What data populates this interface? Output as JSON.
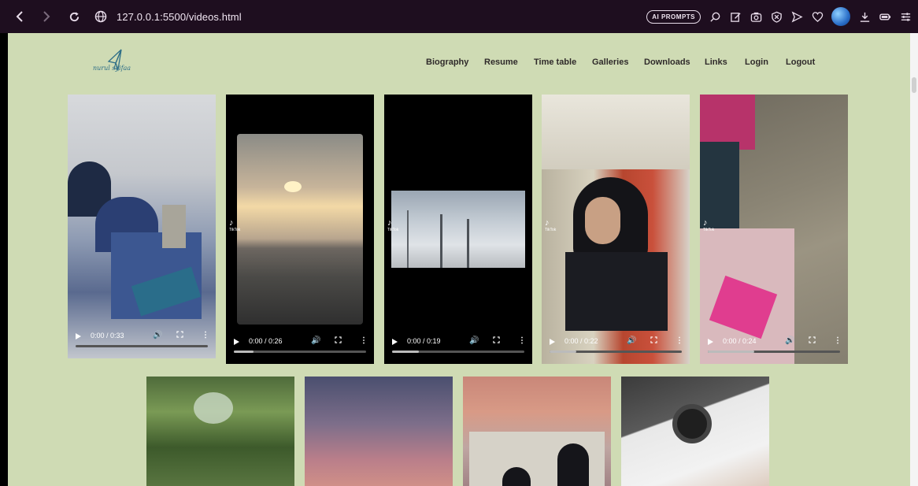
{
  "browser": {
    "url": "127.0.0.1:5500/videos.html",
    "ai_button_label": "AI PROMPTS",
    "back_icon": "chevron-left-icon",
    "forward_icon": "chevron-right-icon",
    "reload_icon": "reload-icon",
    "site_icon": "globe-icon"
  },
  "site": {
    "logo_text": "nurul syifaa",
    "nav": [
      "Biography",
      "Resume",
      "Time table",
      "Galleries",
      "Downloads",
      "Links",
      "Login",
      "Logout"
    ]
  },
  "videos": [
    {
      "time": "0:00 / 0:33",
      "progress": 0.0
    },
    {
      "time": "0:00 / 0:26",
      "progress": 0.15,
      "tiktok": "TikTok"
    },
    {
      "time": "0:00 / 0:19",
      "progress": 0.2,
      "tiktok": "TikTok"
    },
    {
      "time": "0:00 / 0:22",
      "progress": 0.2,
      "tiktok": "TikTok"
    },
    {
      "time": "0:00 / 0:24",
      "progress": 0.35,
      "tiktok": "TikTok"
    }
  ],
  "colors": {
    "page_bg": "#cfdbb4",
    "browser_bar": "#1e0e1f",
    "nav_text": "#2f2a2a"
  }
}
